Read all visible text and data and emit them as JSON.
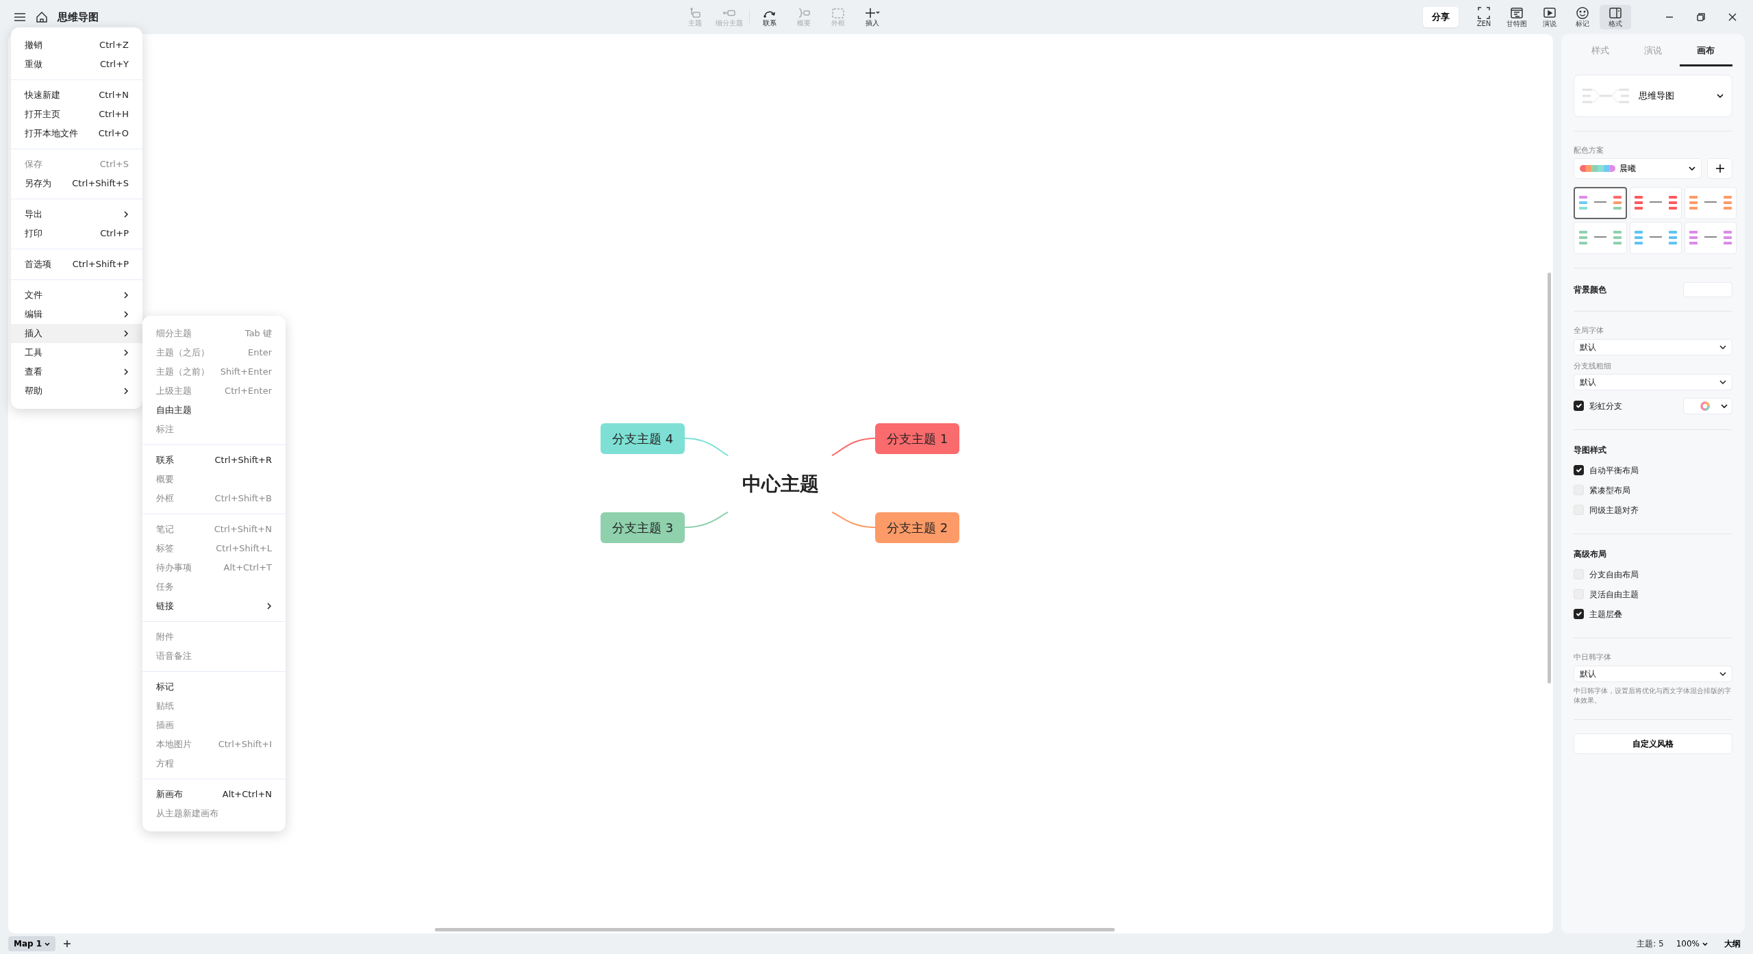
{
  "window": {
    "title": "思维导图"
  },
  "toolbar": [
    {
      "label": "主题",
      "disabled": true
    },
    {
      "label": "细分主题",
      "disabled": true
    },
    {
      "label": "联系",
      "disabled": false
    },
    {
      "label": "概要",
      "disabled": true
    },
    {
      "label": "外框",
      "disabled": true
    },
    {
      "label": "插入",
      "disabled": false
    }
  ],
  "share_button": "分享",
  "view_buttons": [
    {
      "label": "ZEN",
      "selected": false
    },
    {
      "label": "甘特图",
      "selected": false
    },
    {
      "label": "演说",
      "selected": false
    },
    {
      "label": "标记",
      "selected": false
    },
    {
      "label": "格式",
      "selected": true
    }
  ],
  "main_menu": [
    [
      {
        "label": "撤销",
        "shortcut": "Ctrl+Z",
        "disabled": false,
        "selected": false
      },
      {
        "label": "重做",
        "shortcut": "Ctrl+Y",
        "disabled": false,
        "selected": false
      }
    ],
    [
      {
        "label": "快速新建",
        "shortcut": "Ctrl+N",
        "disabled": false,
        "selected": false
      },
      {
        "label": "打开主页",
        "shortcut": "Ctrl+H",
        "disabled": false,
        "selected": false
      },
      {
        "label": "打开本地文件",
        "shortcut": "Ctrl+O",
        "disabled": false,
        "selected": false
      }
    ],
    [
      {
        "label": "保存",
        "shortcut": "Ctrl+S",
        "disabled": true,
        "selected": false
      },
      {
        "label": "另存为",
        "shortcut": "Ctrl+Shift+S",
        "disabled": false,
        "selected": false
      }
    ],
    [
      {
        "label": "导出",
        "has_submenu": true,
        "disabled": false,
        "selected": false
      },
      {
        "label": "打印",
        "shortcut": "Ctrl+P",
        "disabled": false,
        "selected": false
      }
    ],
    [
      {
        "label": "首选项",
        "shortcut": "Ctrl+Shift+P",
        "disabled": false,
        "selected": false
      }
    ],
    [
      {
        "label": "文件",
        "has_submenu": true,
        "disabled": false,
        "selected": false
      },
      {
        "label": "编辑",
        "has_submenu": true,
        "disabled": false,
        "selected": false
      },
      {
        "label": "插入",
        "has_submenu": true,
        "disabled": false,
        "selected": true
      },
      {
        "label": "工具",
        "has_submenu": true,
        "disabled": false,
        "selected": false
      },
      {
        "label": "查看",
        "has_submenu": true,
        "disabled": false,
        "selected": false
      },
      {
        "label": "帮助",
        "has_submenu": true,
        "disabled": false,
        "selected": false
      }
    ]
  ],
  "insert_submenu": [
    [
      {
        "label": "细分主题",
        "shortcut": "Tab 键",
        "disabled": true,
        "selected": false
      },
      {
        "label": "主题（之后）",
        "shortcut": "Enter",
        "disabled": true,
        "selected": false
      },
      {
        "label": "主题（之前）",
        "shortcut": "Shift+Enter",
        "disabled": true,
        "selected": false
      },
      {
        "label": "上级主题",
        "shortcut": "Ctrl+Enter",
        "disabled": true,
        "selected": false
      },
      {
        "label": "自由主题",
        "disabled": false,
        "selected": false
      },
      {
        "label": "标注",
        "disabled": true,
        "selected": false
      }
    ],
    [
      {
        "label": "联系",
        "shortcut": "Ctrl+Shift+R",
        "disabled": false,
        "selected": false
      },
      {
        "label": "概要",
        "disabled": true,
        "selected": false
      },
      {
        "label": "外框",
        "shortcut": "Ctrl+Shift+B",
        "disabled": true,
        "selected": false
      }
    ],
    [
      {
        "label": "笔记",
        "shortcut": "Ctrl+Shift+N",
        "disabled": true,
        "selected": false
      },
      {
        "label": "标签",
        "shortcut": "Ctrl+Shift+L",
        "disabled": true,
        "selected": false
      },
      {
        "label": "待办事项",
        "shortcut": "Alt+Ctrl+T",
        "disabled": true,
        "selected": false
      },
      {
        "label": "任务",
        "disabled": true,
        "selected": false
      },
      {
        "label": "链接",
        "has_submenu": true,
        "disabled": false,
        "selected": false
      }
    ],
    [
      {
        "label": "附件",
        "disabled": true,
        "selected": false
      },
      {
        "label": "语音备注",
        "disabled": true,
        "selected": false
      }
    ],
    [
      {
        "label": "标记",
        "disabled": false,
        "selected": false
      },
      {
        "label": "贴纸",
        "disabled": true,
        "selected": false
      },
      {
        "label": "插画",
        "disabled": true,
        "selected": false
      },
      {
        "label": "本地图片",
        "shortcut": "Ctrl+Shift+I",
        "disabled": true,
        "selected": false
      },
      {
        "label": "方程",
        "disabled": true,
        "selected": false
      }
    ],
    [
      {
        "label": "新画布",
        "shortcut": "Alt+Ctrl+N",
        "disabled": false,
        "selected": false
      },
      {
        "label": "从主题新建画布",
        "disabled": true,
        "selected": false
      }
    ]
  ],
  "mind_map": {
    "central_topic": "中心主题",
    "branches": [
      {
        "label": "分支主题 4",
        "color": "#7ee0d5"
      },
      {
        "label": "分支主题 1",
        "color": "#fa6b6d"
      },
      {
        "label": "分支主题 3",
        "color": "#8fd1ad"
      },
      {
        "label": "分支主题 2",
        "color": "#fd9b68"
      }
    ]
  },
  "format_panel": {
    "tabs": [
      {
        "label": "样式",
        "selected": false
      },
      {
        "label": "演说",
        "selected": false
      },
      {
        "label": "画布",
        "selected": true
      }
    ],
    "structure": "思维导图",
    "color_scheme": {
      "label": "配色方案",
      "value": "晨曦"
    },
    "themes": [
      {
        "selected": true
      },
      {
        "selected": false
      },
      {
        "selected": false
      },
      {
        "selected": false
      },
      {
        "selected": false
      },
      {
        "selected": false
      }
    ],
    "background_color": "背景颜色",
    "global_font": {
      "label": "全局字体",
      "value": "默认"
    },
    "branch_line_width": {
      "label": "分支线粗细",
      "value": "默认"
    },
    "rainbow_branch": {
      "label": "彩虹分支",
      "checked": true
    },
    "sections": [
      {
        "title": "导图样式",
        "options": [
          {
            "label": "自动平衡布局",
            "checked": true
          },
          {
            "label": "紧凑型布局",
            "checked": false
          },
          {
            "label": "同级主题对齐",
            "checked": false
          }
        ]
      },
      {
        "title": "高级布局",
        "options": [
          {
            "label": "分支自由布局",
            "checked": false
          },
          {
            "label": "灵活自由主题",
            "checked": false
          },
          {
            "label": "主题层叠",
            "checked": true
          }
        ]
      }
    ],
    "cjk_font": {
      "label": "中日韩字体",
      "value": "默认",
      "hint": "中日韩字体，设置后将优化与西文字体混合排版的字体效果。"
    },
    "custom_style_button": "自定义风格"
  },
  "sheet_tabs": [
    {
      "label": "Map 1",
      "selected": true
    }
  ],
  "status_bar": {
    "topic_count": "主题: 5",
    "zoom": "100%",
    "outline_button": "大纲"
  }
}
